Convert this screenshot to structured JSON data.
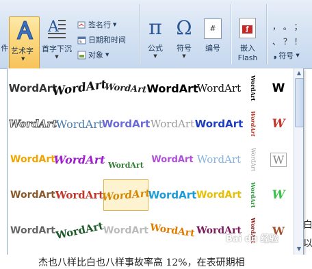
{
  "ribbon": {
    "items": {
      "part_label": "件",
      "wordart_label": "艺术字",
      "dropcap_label": "首字下沉",
      "signature_label": "签名行",
      "datetime_label": "日期和时间",
      "object_label": "对象",
      "equation_label": "公式",
      "symbol_label": "符号",
      "number_label": "编号",
      "embed_flash_label_1": "嵌入",
      "embed_flash_label_2": "Flash",
      "symbol_small_label": "符号",
      "punct_row1": "，  。  ；",
      "punct_row2": "、  ？  ！"
    }
  },
  "gallery": {
    "title_text": "WordArt",
    "rows": [
      [
        "WordArt",
        "WordArt",
        "WordArt",
        "WordArt",
        "WordArt",
        "WordArt",
        "W"
      ],
      [
        "WordArt",
        "WordArt",
        "WordArt",
        "WordArt",
        "WordArt",
        "WordArt",
        "W"
      ],
      [
        "WordArt",
        "WordArt",
        "WordArt",
        "WordArt",
        "WordArt",
        "WordArt",
        "W"
      ],
      [
        "WordArt",
        "WordArt",
        "WordArt",
        "WordArt",
        "WordArt",
        "WordArt",
        "W"
      ],
      [
        "WordArt",
        "WordArt",
        "WordArt",
        "WordArt",
        "WordArt",
        "WordArt",
        "W"
      ]
    ],
    "vertical_text": "WordArt"
  },
  "document": {
    "bottom_line": "杰也八样比白也八样事故率高 12%，在表研期相",
    "side_char_1": "白",
    "side_char_2": "以"
  },
  "watermark": "Bai du 经验"
}
